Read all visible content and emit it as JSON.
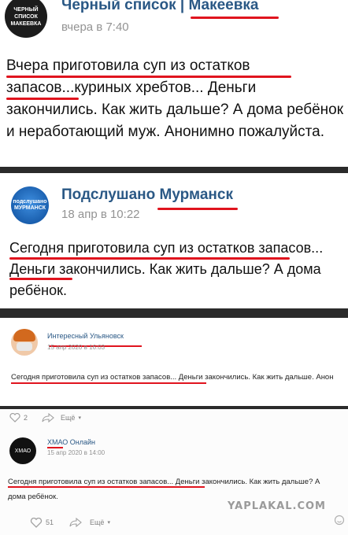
{
  "post1": {
    "avatar_text": "ЧЕРНЫЙ СПИСОК МАКЕЕВКА",
    "author": "Черный список | Макеевка",
    "date": "вчера в 7:40",
    "text": "Вчера приготовила суп из остатков запасов...куриных хребтов... Деньги закончились. Как жить дальше? А дома ребёнок и неработающий муж. Анонимно пожалуйста."
  },
  "post2": {
    "avatar_text": "подслушано МУРМАНСК",
    "author": "Подслушано Мурманск",
    "date": "18 апр в 10:22",
    "text": "Сегодня приготовила суп из остатков запасов... Деньги закончились. Как жить дальше? А дома ребёнок."
  },
  "post3": {
    "author": "Интересный Ульяновск",
    "date": "15 апр 2020 в 16:03",
    "text": "Сегодня приготовила суп из остатков запасов... Деньги закончились. Как жить дальше. Анон"
  },
  "post3_actions": {
    "likes": "2",
    "more": "Ещё"
  },
  "post4": {
    "avatar_text": "ХМАО",
    "author": "ХМАО Онлайн",
    "date": "15 апр 2020 в 14:00",
    "text": "Сегодня приготовила суп из остатков запасов... Деньги закончились. Как жить дальше? А дома ребёнок."
  },
  "post4_actions": {
    "likes": "51",
    "more": "Ещё"
  },
  "watermark": "YAPLAKAL.COM",
  "colors": {
    "underline": "#e0141e",
    "author": "#2a5885",
    "date": "#939393"
  }
}
